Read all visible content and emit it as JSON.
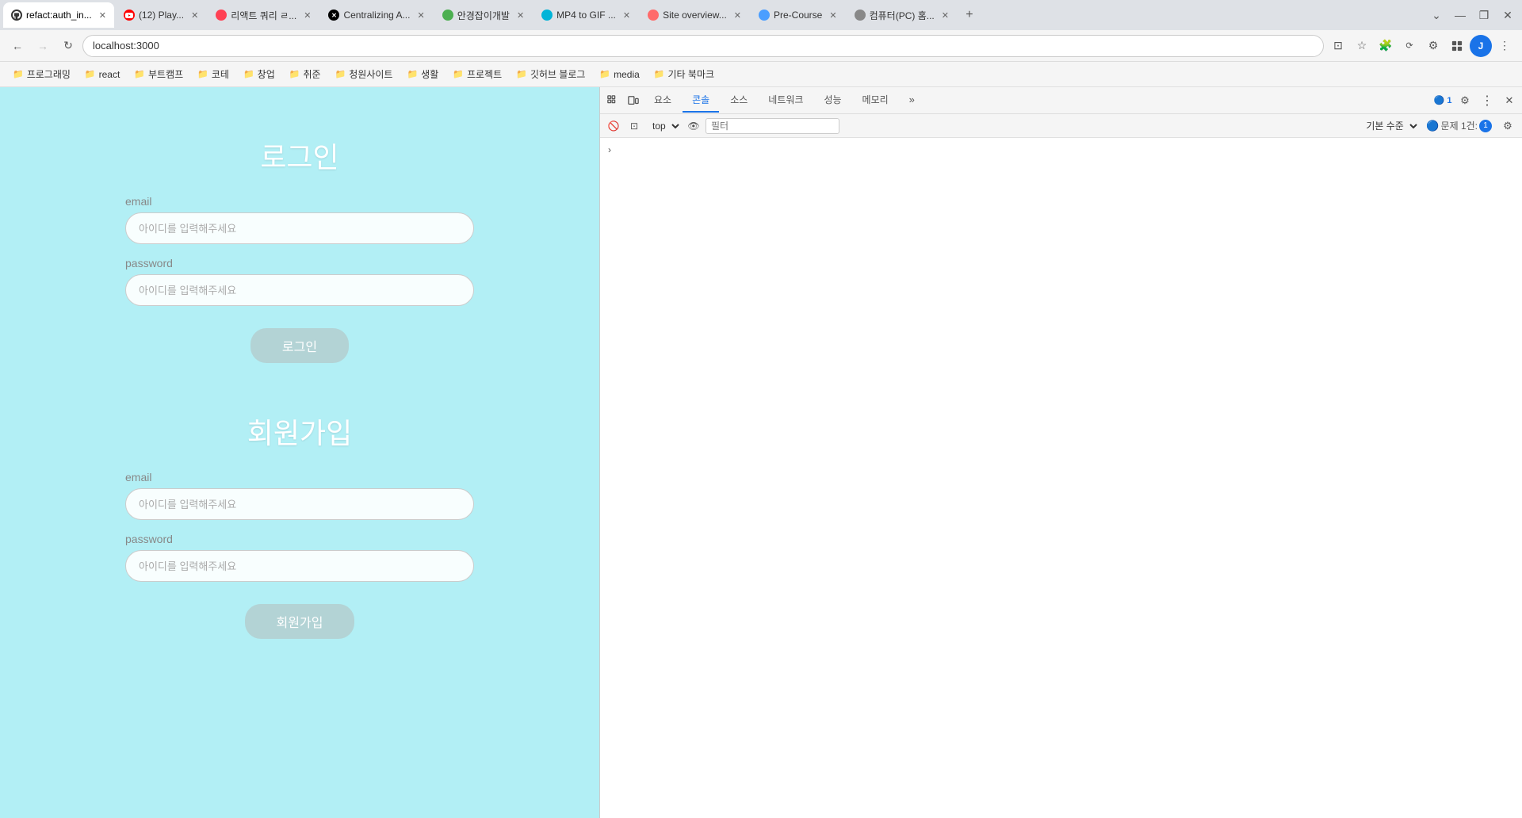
{
  "browser": {
    "tabs": [
      {
        "id": "tab-refact",
        "label": "refact:auth_in...",
        "icon_color": "#333",
        "icon_type": "github",
        "active": true,
        "closable": true
      },
      {
        "id": "tab-yt",
        "label": "(12) Play...",
        "icon_color": "#ff0000",
        "icon_type": "yt",
        "active": false,
        "closable": true
      },
      {
        "id": "tab-query",
        "label": "리액트 쿼리 ㄹ...",
        "icon_color": "#ff4154",
        "icon_type": "query",
        "active": false,
        "closable": true
      },
      {
        "id": "tab-cent",
        "label": "Centralizing A...",
        "icon_color": "#000",
        "icon_type": "x",
        "active": false,
        "closable": true
      },
      {
        "id": "tab-env",
        "label": "안경잡이개발",
        "icon_color": "#4caf50",
        "icon_type": "env",
        "active": false,
        "closable": true
      },
      {
        "id": "tab-mp4",
        "label": "MP4 to GIF ...",
        "icon_color": "#00b4d8",
        "icon_type": "mp4",
        "active": false,
        "closable": true
      },
      {
        "id": "tab-site",
        "label": "Site overview...",
        "icon_color": "#ff6b6b",
        "icon_type": "diamond",
        "active": false,
        "closable": true
      },
      {
        "id": "tab-pre",
        "label": "Pre-Course",
        "icon_color": "#4a9eff",
        "icon_type": "pre",
        "active": false,
        "closable": true
      },
      {
        "id": "tab-pc",
        "label": "컴퓨터(PC) 홈...",
        "icon_color": "#888",
        "icon_type": "pc",
        "active": false,
        "closable": true
      }
    ],
    "address": "localhost:3000",
    "new_tab_label": "+",
    "window_controls": {
      "minimize": "—",
      "maximize": "❐",
      "close": "✕"
    }
  },
  "bookmarks": [
    {
      "label": "프로그래밍",
      "type": "folder"
    },
    {
      "label": "react",
      "type": "folder"
    },
    {
      "label": "부트캠프",
      "type": "folder"
    },
    {
      "label": "코테",
      "type": "folder"
    },
    {
      "label": "창업",
      "type": "folder"
    },
    {
      "label": "취준",
      "type": "folder"
    },
    {
      "label": "청원사이트",
      "type": "folder"
    },
    {
      "label": "생활",
      "type": "folder"
    },
    {
      "label": "프로젝트",
      "type": "folder"
    },
    {
      "label": "깃허브 블로그",
      "type": "folder"
    },
    {
      "label": "media",
      "type": "folder"
    },
    {
      "label": "기타 북마크",
      "type": "folder"
    }
  ],
  "webpage": {
    "background_color": "#b2eff5",
    "login": {
      "title": "로그인",
      "email_label": "email",
      "email_placeholder": "아이디를 입력해주세요",
      "password_label": "password",
      "password_placeholder": "아이디를 입력해주세요",
      "button_label": "로그인"
    },
    "signup": {
      "title": "회원가입",
      "email_label": "email",
      "email_placeholder": "아이디를 입력해주세요",
      "password_label": "password",
      "password_placeholder": "아이디를 입력해주세요",
      "button_label": "회원가입"
    }
  },
  "devtools": {
    "tabs": [
      {
        "label": "요소",
        "active": false
      },
      {
        "label": "콘솔",
        "active": true
      },
      {
        "label": "소스",
        "active": false
      },
      {
        "label": "네트워크",
        "active": false
      },
      {
        "label": "성능",
        "active": false
      },
      {
        "label": "메모리",
        "active": false
      }
    ],
    "sub_bar": {
      "top_value": "top",
      "filter_label": "필터",
      "level_label": "기본 수준",
      "issue_count": "문제 1건:",
      "issue_icon_count": "1"
    },
    "settings_gear": "⚙",
    "more_options": "⋮",
    "close_label": "✕",
    "dock_label": "⊡",
    "detach_label": "⧉",
    "inspect_label": "⊡",
    "device_label": "☐",
    "eye_label": "👁",
    "arrow_label": "›"
  }
}
